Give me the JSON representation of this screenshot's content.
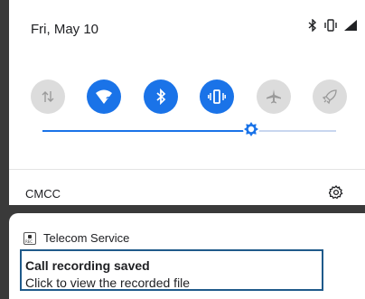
{
  "status": {
    "date": "Fri, May 10",
    "icons": [
      "bluetooth-icon",
      "vibrate-icon",
      "signal-icon"
    ]
  },
  "quick_tiles": [
    {
      "name": "mobile-data",
      "icon": "data-arrows-icon",
      "state": "off"
    },
    {
      "name": "wifi",
      "icon": "wifi-question-icon",
      "state": "on"
    },
    {
      "name": "bluetooth",
      "icon": "bluetooth-icon",
      "state": "on"
    },
    {
      "name": "vibrate",
      "icon": "vibrate-icon",
      "state": "on"
    },
    {
      "name": "airplane-mode",
      "icon": "airplane-icon",
      "state": "off"
    },
    {
      "name": "rocket",
      "icon": "rocket-icon",
      "state": "off"
    }
  ],
  "brightness": {
    "level": 0.71
  },
  "carrier": {
    "name": "CMCC"
  },
  "notification": {
    "app_name": "Telecom Service",
    "title": "Call recording saved",
    "text": "Click to view the recorded file"
  },
  "colors": {
    "accent": "#1a73e8",
    "tile_off": "#dcdcdc",
    "highlight_border": "#1f5a8a"
  }
}
